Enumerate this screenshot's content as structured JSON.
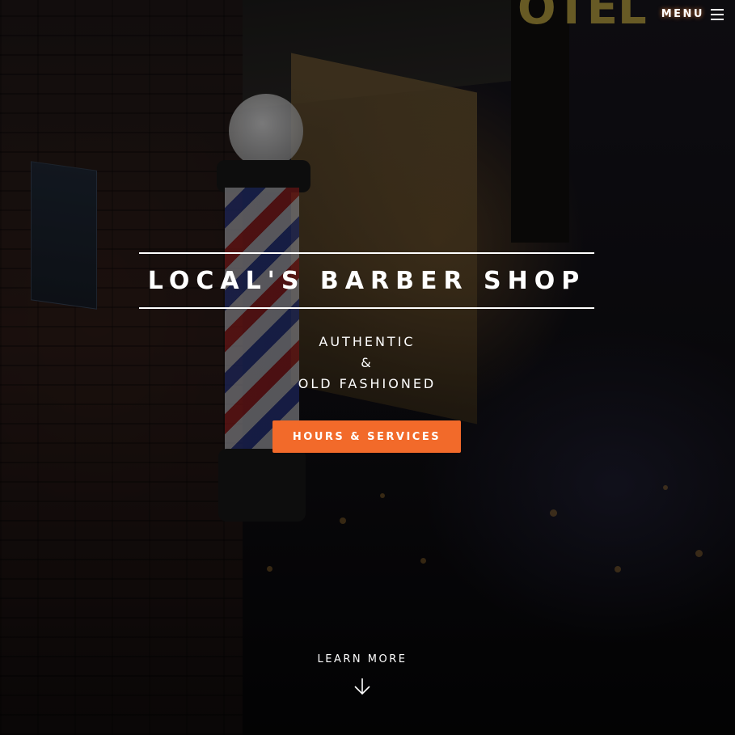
{
  "header": {
    "menu_label": "MENU",
    "menu_icon": "hamburger-icon"
  },
  "hero": {
    "title": "LOCAL'S BARBER SHOP",
    "tagline": [
      "AUTHENTIC",
      "&",
      "OLD FASHIONED"
    ],
    "cta_label": "HOURS & SERVICES",
    "learn_more_label": "LEARN MORE",
    "learn_more_icon": "arrow-down-icon",
    "background_sign_text": "OTEL"
  },
  "colors": {
    "accent": "#f26a2a",
    "text": "#ffffff",
    "background": "#0a0a0c"
  }
}
